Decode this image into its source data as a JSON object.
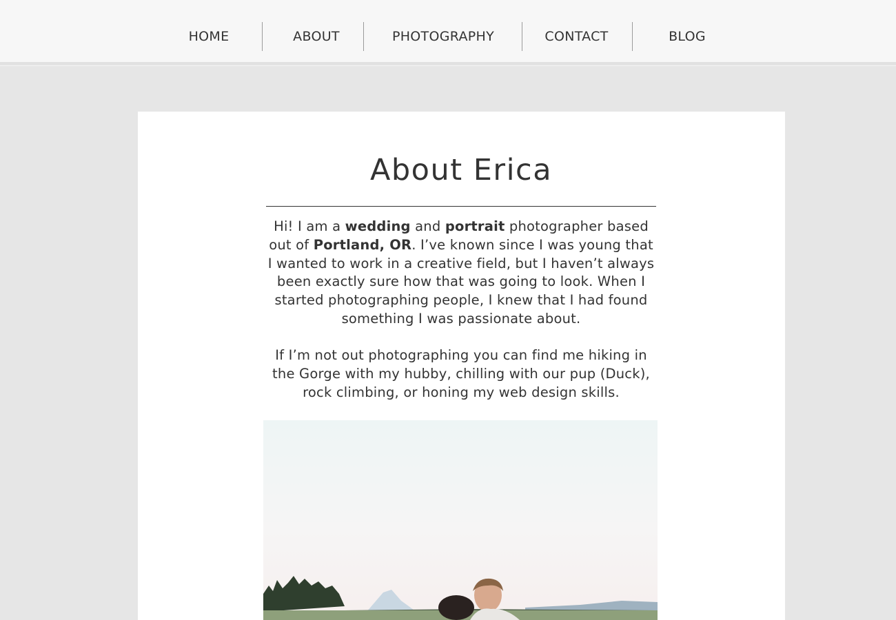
{
  "nav": {
    "items": [
      {
        "label": "HOME"
      },
      {
        "label": "ABOUT"
      },
      {
        "label": "PHOTOGRAPHY"
      },
      {
        "label": "CONTACT"
      },
      {
        "label": "BLOG"
      }
    ]
  },
  "about": {
    "title": "About Erica",
    "p1": {
      "t1": "Hi! I am a ",
      "b1": "wedding",
      "t2": " and ",
      "b2": "portrait",
      "t3": " photographer based out of ",
      "b3": "Portland, OR",
      "t4": ".  I’ve known since I was young that I wanted to work in a creative field, but I haven’t always been exactly sure how that was going to look. When I started photographing people, I knew that I had found something I was passionate about."
    },
    "p2": "If I’m not out photographing you can find me hiking in the Gorge with my hubby, chilling with our pup (Duck), rock climbing, or honing my web design skills."
  },
  "colors": {
    "page_bg": "#e6e6e6",
    "nav_bg": "#f7f7f7",
    "card_bg": "#ffffff",
    "text": "#333333"
  }
}
